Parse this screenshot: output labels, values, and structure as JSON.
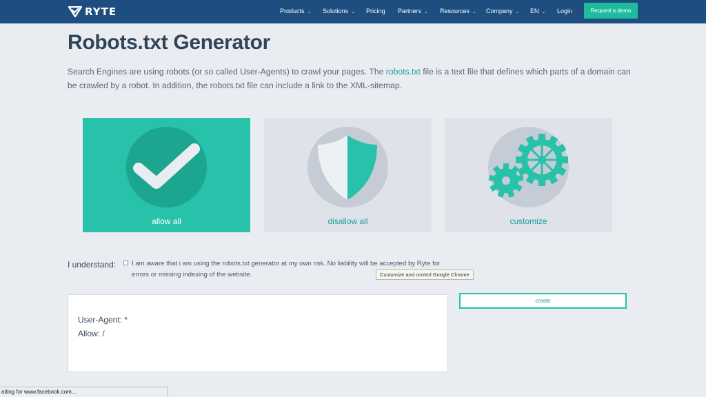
{
  "nav": {
    "brand": "RYTE",
    "items": [
      {
        "label": "Products",
        "has_dropdown": true
      },
      {
        "label": "Solutions",
        "has_dropdown": true
      },
      {
        "label": "Pricing",
        "has_dropdown": false
      },
      {
        "label": "Partners",
        "has_dropdown": true
      },
      {
        "label": "Resources",
        "has_dropdown": true
      },
      {
        "label": "Company",
        "has_dropdown": true
      },
      {
        "label": "EN",
        "has_dropdown": true
      },
      {
        "label": "Login",
        "has_dropdown": false
      }
    ],
    "cta": "Request a demo"
  },
  "page": {
    "title": "Robots.txt Generator",
    "intro_before": "Search Engines are using robots (or so called User-Agents) to crawl your pages. The ",
    "intro_link": "robots.txt",
    "intro_after": " file is a text file that defines which parts of a domain can be crawled by a robot. In addition, the robots.txt file can include a link to the XML-sitemap."
  },
  "options": [
    {
      "label": "allow all",
      "icon": "checkmark-icon",
      "selected": true
    },
    {
      "label": "disallow all",
      "icon": "shield-icon",
      "selected": false
    },
    {
      "label": "customize",
      "icon": "gears-icon",
      "selected": false
    }
  ],
  "consent": {
    "label": "I understand:",
    "checked": false,
    "text": "I am aware that i am using the robots.txt generator at my own risk. No liability will be accepted by Ryte for errors or missing indexing of the website."
  },
  "tooltip": "Customize and control Google Chrome",
  "output": {
    "line1": "User-Agent: *",
    "line2": "Allow: /"
  },
  "create_button": "create",
  "status_bar": "aiting for www.facebook.com...",
  "colors": {
    "nav_bg": "#1d4e7f",
    "accent": "#27c2a9",
    "link": "#1e9fa0",
    "page_bg": "#e9ecf0"
  }
}
